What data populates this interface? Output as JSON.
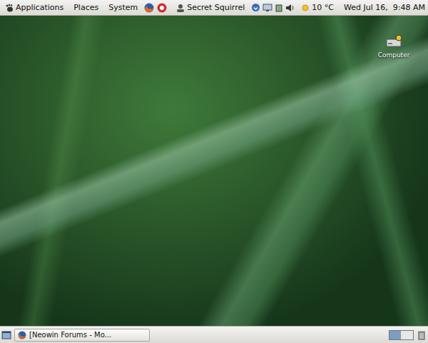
{
  "top_panel": {
    "menus": [
      {
        "label": "Applications"
      },
      {
        "label": "Places"
      },
      {
        "label": "System"
      }
    ],
    "user": "Secret Squirrel",
    "weather": "10 °C",
    "clock": "Wed Jul 16,  9:48 AM"
  },
  "desktop": {
    "icons": [
      {
        "label": "Computer"
      }
    ]
  },
  "bottom_panel": {
    "tasks": [
      {
        "label": "[Neowin Forums - Mo...",
        "selected": false
      }
    ],
    "workspaces": [
      {
        "selected": true
      },
      {
        "selected": false
      }
    ]
  }
}
